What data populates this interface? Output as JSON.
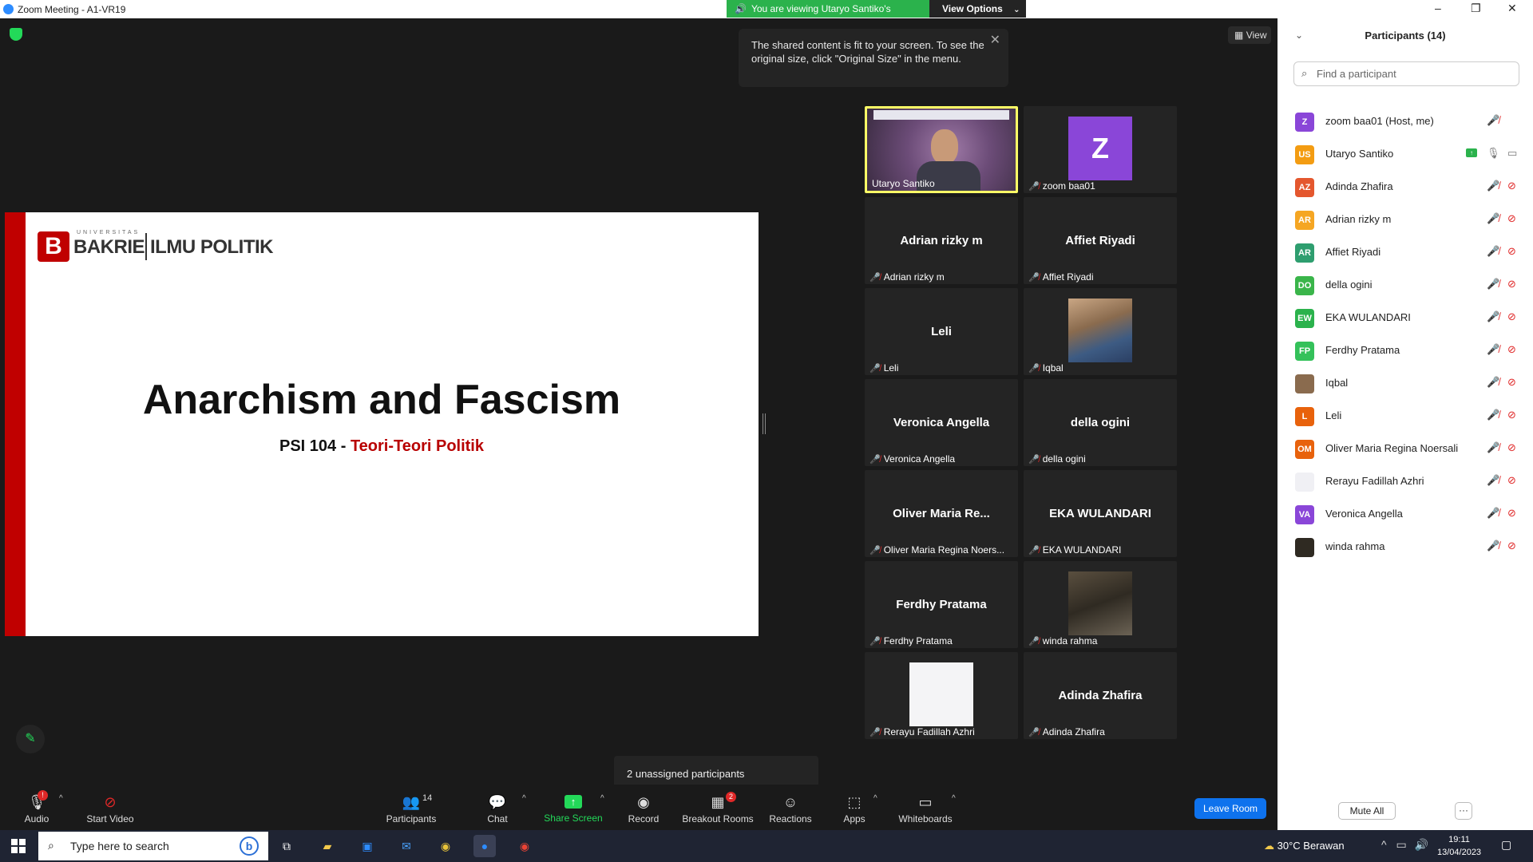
{
  "window": {
    "title": "Zoom Meeting - A1-VR19",
    "share_banner": "You are viewing Utaryo Santiko's screen",
    "view_options": "View Options",
    "minimize": "–",
    "restore": "❐",
    "close": "✕"
  },
  "meeting": {
    "view_label": "View",
    "tooltip": "The shared content is fit to your screen. To see the original size, click \"Original Size\" in the menu.",
    "unassigned": "2 unassigned participants"
  },
  "slide": {
    "logo_sub": "UNIVERSITAS",
    "logo_left": "BAKRIE",
    "logo_right": "ILMU POLITIK",
    "title": "Anarchism and Fascism",
    "subtitle_code": "PSI 104 - ",
    "subtitle_course": "Teori-Teori Politik"
  },
  "grid": [
    {
      "label": "Utaryo Santiko",
      "name": "",
      "type": "video",
      "muted": false
    },
    {
      "label": "zoom baa01",
      "name": "",
      "type": "avatar-z",
      "letter": "Z",
      "muted": true
    },
    {
      "label": "Adrian rizky m",
      "name": "Adrian rizky m",
      "type": "name",
      "muted": true
    },
    {
      "label": "Affiet Riyadi",
      "name": "Affiet Riyadi",
      "type": "name",
      "muted": true
    },
    {
      "label": "Leli",
      "name": "Leli",
      "type": "name",
      "muted": true
    },
    {
      "label": "Iqbal",
      "name": "",
      "type": "photo1",
      "muted": true
    },
    {
      "label": "Veronica Angella",
      "name": "Veronica Angella",
      "type": "name",
      "muted": true
    },
    {
      "label": "della ogini",
      "name": "della ogini",
      "type": "name",
      "muted": true
    },
    {
      "label": "Oliver Maria Regina Noers...",
      "name": "Oliver  Maria  Re...",
      "type": "name",
      "muted": true
    },
    {
      "label": "EKA WULANDARI",
      "name": "EKA WULANDARI",
      "type": "name",
      "muted": true
    },
    {
      "label": "Ferdhy Pratama",
      "name": "Ferdhy Pratama",
      "type": "name",
      "muted": true
    },
    {
      "label": "winda rahma",
      "name": "",
      "type": "photo2",
      "muted": true
    },
    {
      "label": "Rerayu Fadillah Azhri",
      "name": "",
      "type": "white",
      "muted": true
    },
    {
      "label": "Adinda Zhafira",
      "name": "Adinda Zhafira",
      "type": "name",
      "muted": true
    }
  ],
  "toolbar": {
    "audio": "Audio",
    "audio_badge": "!",
    "start_video": "Start Video",
    "participants": "Participants",
    "participants_count": "14",
    "chat": "Chat",
    "share_screen": "Share Screen",
    "record": "Record",
    "breakout_rooms": "Breakout Rooms",
    "breakout_badge": "2",
    "reactions": "Reactions",
    "apps": "Apps",
    "whiteboards": "Whiteboards",
    "leave_room": "Leave Room"
  },
  "panel": {
    "title": "Participants (14)",
    "search_placeholder": "Find a participant",
    "mute_all": "Mute All",
    "more": "···",
    "participants": [
      {
        "initials": "Z",
        "name": "zoom baa01 (Host, me)",
        "color": "#8a46d8",
        "mic": "off",
        "cam": "none"
      },
      {
        "initials": "US",
        "name": "Utaryo Santiko",
        "color": "#f39c12",
        "mic": "on",
        "cam": "on",
        "sharing": true
      },
      {
        "initials": "AZ",
        "name": "Adinda Zhafira",
        "color": "#e4572e",
        "mic": "off",
        "cam": "off"
      },
      {
        "initials": "AR",
        "name": "Adrian rizky m",
        "color": "#f5a623",
        "mic": "off",
        "cam": "off"
      },
      {
        "initials": "AR",
        "name": "Affiet Riyadi",
        "color": "#2e9e6f",
        "mic": "off",
        "cam": "off"
      },
      {
        "initials": "DO",
        "name": "della ogini",
        "color": "#3ab54a",
        "mic": "off",
        "cam": "off"
      },
      {
        "initials": "EW",
        "name": "EKA WULANDARI",
        "color": "#2bb24c",
        "mic": "off",
        "cam": "off"
      },
      {
        "initials": "FP",
        "name": "Ferdhy Pratama",
        "color": "#34c15a",
        "mic": "off",
        "cam": "off"
      },
      {
        "initials": "",
        "name": "Iqbal",
        "color": "#8a6b4e",
        "mic": "off",
        "cam": "off"
      },
      {
        "initials": "L",
        "name": "Leli",
        "color": "#e8620c",
        "mic": "off",
        "cam": "off"
      },
      {
        "initials": "OM",
        "name": "Oliver Maria Regina Noersali",
        "color": "#e8620c",
        "mic": "off",
        "cam": "off"
      },
      {
        "initials": "",
        "name": "Rerayu Fadillah Azhri",
        "color": "#f0f0f4",
        "mic": "off",
        "cam": "off"
      },
      {
        "initials": "VA",
        "name": "Veronica Angella",
        "color": "#8a46d8",
        "mic": "off",
        "cam": "off"
      },
      {
        "initials": "",
        "name": "winda rahma",
        "color": "#2f2a22",
        "mic": "off",
        "cam": "off"
      }
    ]
  },
  "taskbar": {
    "search_placeholder": "Type here to search",
    "weather": "30°C  Berawan",
    "time": "19:11",
    "date": "13/04/2023"
  }
}
